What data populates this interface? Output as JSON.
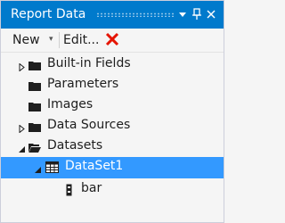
{
  "panel": {
    "title": "Report Data",
    "menu_icon": "dropdown-triangle-icon",
    "pin_icon": "pin-icon",
    "close_icon": "close-icon"
  },
  "toolbar": {
    "new_label": "New",
    "new_caret": "▾",
    "edit_label": "Edit...",
    "delete_icon": "red-x-delete-icon"
  },
  "tree": {
    "builtin_fields": "Built-in Fields",
    "parameters": "Parameters",
    "images": "Images",
    "data_sources": "Data Sources",
    "datasets": "Datasets",
    "dataset1": "DataSet1",
    "field_bar": "bar"
  },
  "colors": {
    "titlebar": "#007acc",
    "selection": "#3399ff",
    "delete_red": "#e51400"
  }
}
